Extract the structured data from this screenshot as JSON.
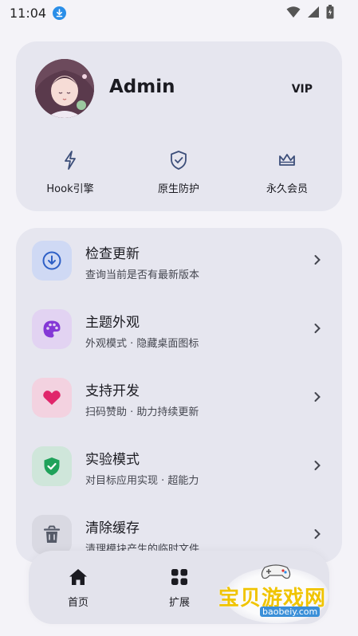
{
  "status_bar": {
    "time": "11:04"
  },
  "profile": {
    "name": "Admin",
    "badge": "VIP",
    "features": [
      {
        "label": "Hook引擎",
        "icon": "lightning-icon"
      },
      {
        "label": "原生防护",
        "icon": "shield-check-icon"
      },
      {
        "label": "永久会员",
        "icon": "crown-icon"
      }
    ]
  },
  "menu": [
    {
      "title": "检查更新",
      "subtitle": "查询当前是否有最新版本",
      "icon": "download-icon",
      "icon_bg": "#cfd9f4",
      "icon_color": "#2e5fc6"
    },
    {
      "title": "主题外观",
      "subtitle": "外观模式 · 隐藏桌面图标",
      "icon": "palette-icon",
      "icon_bg": "#e2d3f2",
      "icon_color": "#8438d6"
    },
    {
      "title": "支持开发",
      "subtitle": "扫码赞助 · 助力持续更新",
      "icon": "heart-icon",
      "icon_bg": "#f3d2e0",
      "icon_color": "#e0266b"
    },
    {
      "title": "实验模式",
      "subtitle": "对目标应用实现 · 超能力",
      "icon": "shield-check-icon",
      "icon_bg": "#cfe6da",
      "icon_color": "#1fa25a"
    },
    {
      "title": "清除缓存",
      "subtitle": "清理模块产生的临时文件",
      "icon": "trash-icon",
      "icon_bg": "#d9d9e2",
      "icon_color": "#555a68"
    }
  ],
  "bottom_nav": [
    {
      "label": "首页",
      "icon": "home-icon"
    },
    {
      "label": "扩展",
      "icon": "grid-icon"
    }
  ],
  "watermark": {
    "text": "宝贝游戏网",
    "url": "baobeiy.com"
  }
}
